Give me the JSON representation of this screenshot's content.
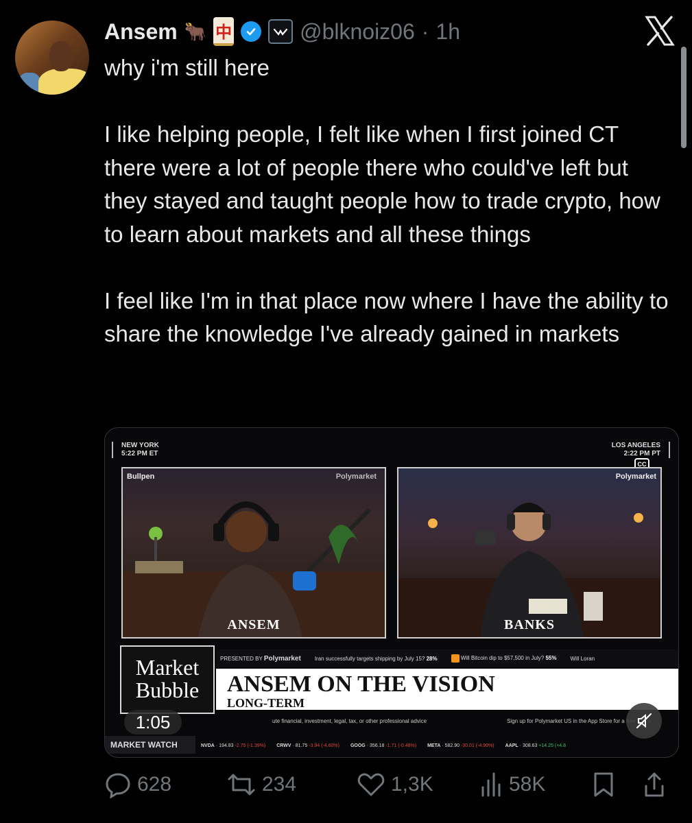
{
  "tweet": {
    "author_name": "Ansem",
    "author_emoji": "🐂",
    "mahjong_tile": "中",
    "handle": "@blknoiz06",
    "separator": "·",
    "time_ago": "1h",
    "paragraphs": [
      "why i'm still here",
      "I like helping people, I felt like when I first joined CT there were a lot of people there who could've left but they stayed and taught people how to trade crypto, how to learn about markets and all these things",
      "I feel like I'm in that place now where I have the ability to share the knowledge I've already gained in markets"
    ]
  },
  "video": {
    "city_left": "NEW YORK",
    "time_left": "5:22 PM ET",
    "city_right": "LOS ANGELES",
    "time_right": "2:22 PM PT",
    "cc": "CC",
    "brand_left": "Bullpen",
    "brand_polymarket": "Polymarket",
    "guest_left": "ANSEM",
    "guest_right": "BANKS",
    "show_logo": "Market Bubble",
    "presented_by": "PRESENTED BY",
    "markets": [
      {
        "text": "Iran successfully targets shipping by July 15?",
        "pct": "28%"
      },
      {
        "text": "Will Bitcoin dip to $57,500 in July?",
        "pct": "55%"
      },
      {
        "text": "Will Loran",
        "pct": ""
      }
    ],
    "headline": "ANSEM ON THE VISION",
    "subheadline": "LONG-TERM",
    "disclaimer_left": "ute financial, investment, legal, tax, or other professional advice",
    "disclaimer_right": "Sign up for Polymarket US in the App Store for a free $20 u",
    "elapsed": "1:05",
    "market_watch": "MARKET WATCH",
    "stocks": [
      {
        "sym": "NVDA",
        "price": "194.83",
        "chg": "-2.75 (-1.39%)",
        "dir": "neg"
      },
      {
        "sym": "CRWV",
        "price": "81.75",
        "chg": "-3.94 (-4.60%)",
        "dir": "neg"
      },
      {
        "sym": "GOOG",
        "price": "356.18",
        "chg": "-1.71 (-0.48%)",
        "dir": "neg"
      },
      {
        "sym": "META",
        "price": "582.90",
        "chg": "-30.01 (-4.90%)",
        "dir": "neg"
      },
      {
        "sym": "AAPL",
        "price": "308.63",
        "chg": "+14.25 (+4.8",
        "dir": "pos"
      }
    ]
  },
  "actions": {
    "replies": "628",
    "reposts": "234",
    "likes": "1,3K",
    "views": "58K"
  },
  "colors": {
    "background": "#000000",
    "text": "#e7e9ea",
    "muted": "#71767b",
    "verified": "#1d9bf0"
  }
}
